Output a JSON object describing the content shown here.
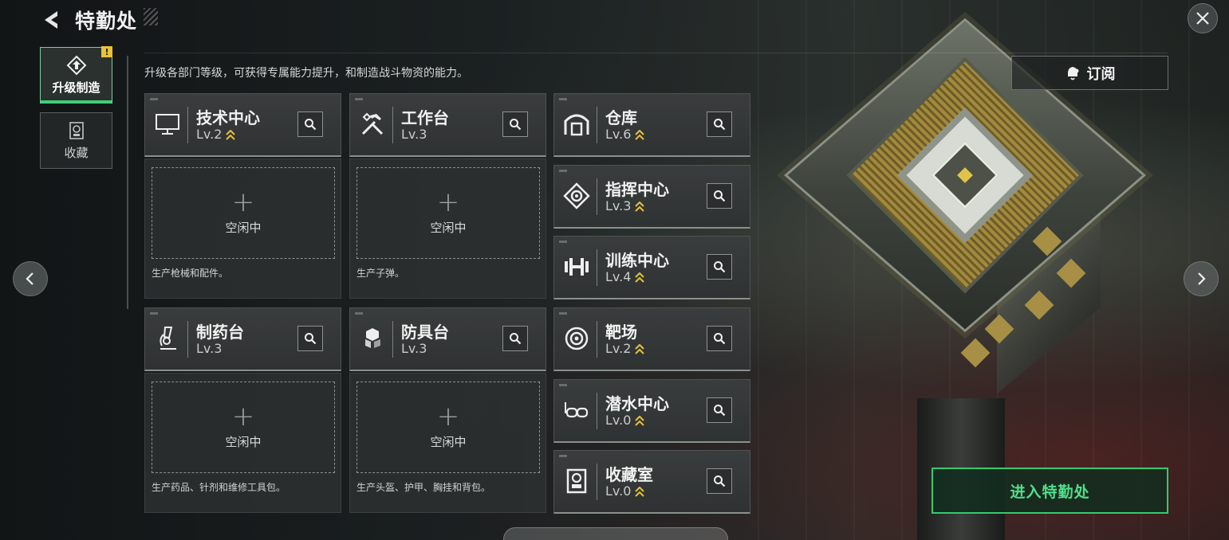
{
  "header": {
    "title": "特勤处"
  },
  "tabs": [
    {
      "label": "升级制造",
      "active": true,
      "icon": "upgrade-icon",
      "badge": "!"
    },
    {
      "label": "收藏",
      "active": false,
      "icon": "collection-icon"
    }
  ],
  "description": "升级各部门等级，可获得专属能力提升，和制造战斗物资的能力。",
  "subscribe_label": "订阅",
  "enter_label": "进入特勤处",
  "buildings": [
    {
      "name": "技术中心",
      "level": "Lv.2",
      "upgradable": true,
      "icon": "monitor-icon"
    },
    {
      "name": "工作台",
      "level": "Lv.3",
      "upgradable": false,
      "icon": "tools-icon"
    },
    {
      "name": "仓库",
      "level": "Lv.6",
      "upgradable": true,
      "icon": "warehouse-icon"
    },
    {
      "name": "指挥中心",
      "level": "Lv.3",
      "upgradable": true,
      "icon": "command-icon"
    },
    {
      "name": "训练中心",
      "level": "Lv.4",
      "upgradable": true,
      "icon": "dumbbell-icon"
    },
    {
      "name": "制药台",
      "level": "Lv.3",
      "upgradable": false,
      "icon": "microscope-icon"
    },
    {
      "name": "防具台",
      "level": "Lv.3",
      "upgradable": false,
      "icon": "armor-blocks-icon"
    },
    {
      "name": "靶场",
      "level": "Lv.2",
      "upgradable": true,
      "icon": "target-icon"
    },
    {
      "name": "潜水中心",
      "level": "Lv.0",
      "upgradable": true,
      "icon": "diving-goggles-icon"
    },
    {
      "name": "收藏室",
      "level": "Lv.0",
      "upgradable": true,
      "icon": "collection-room-icon"
    }
  ],
  "slots": [
    {
      "status": "空闲中",
      "description": "生产枪械和配件。"
    },
    {
      "status": "空闲中",
      "description": "生产子弹。"
    },
    {
      "status": "空闲中",
      "description": "生产药品、针剂和维修工具包。"
    },
    {
      "status": "空闲中",
      "description": "生产头盔、护甲、胸挂和背包。"
    }
  ],
  "colors": {
    "accent_green": "#3fcf78",
    "upgrade_gold": "#e8c23a",
    "badge_yellow": "#e8c23a"
  }
}
